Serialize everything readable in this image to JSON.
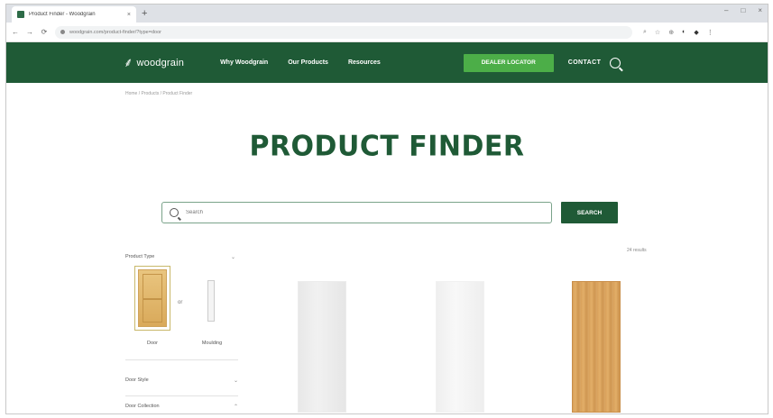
{
  "browser": {
    "tab_title": "Product Finder - Woodgrain",
    "tab_close": "×",
    "new_tab": "+",
    "window_controls": [
      "–",
      "□",
      "×"
    ],
    "nav": {
      "back": "←",
      "forward": "→",
      "reload": "⟳"
    },
    "url": "woodgrain.com/product-finder/?type=door",
    "extension_icons": [
      "⌕",
      "☆",
      "⊕",
      "◐",
      "◆",
      "⋮"
    ]
  },
  "header": {
    "logo_mark": "⸙",
    "logo_text": "woodgrain",
    "nav": [
      "Why Woodgrain",
      "Our Products",
      "Resources"
    ],
    "dealer_button": "DEALER LOCATOR",
    "contact": "CONTACT"
  },
  "breadcrumb": "Home / Products / Product Finder",
  "page": {
    "title": "PRODUCT FINDER"
  },
  "search": {
    "placeholder": "Search",
    "button": "SEARCH"
  },
  "filters": {
    "product_type_label": "Product Type",
    "product_type_chevron": "⌄",
    "types": [
      {
        "label": "Door",
        "selected": true
      },
      {
        "label": "Moulding",
        "selected": false
      }
    ],
    "type_separator": "or",
    "rows": [
      {
        "label": "Door Style",
        "chevron": "⌄"
      },
      {
        "label": "Door Collection",
        "chevron": "⌃"
      }
    ]
  },
  "results": {
    "count": "24 results"
  },
  "colors": {
    "brand_green": "#1f5a36",
    "accent_green": "#4cae48"
  }
}
